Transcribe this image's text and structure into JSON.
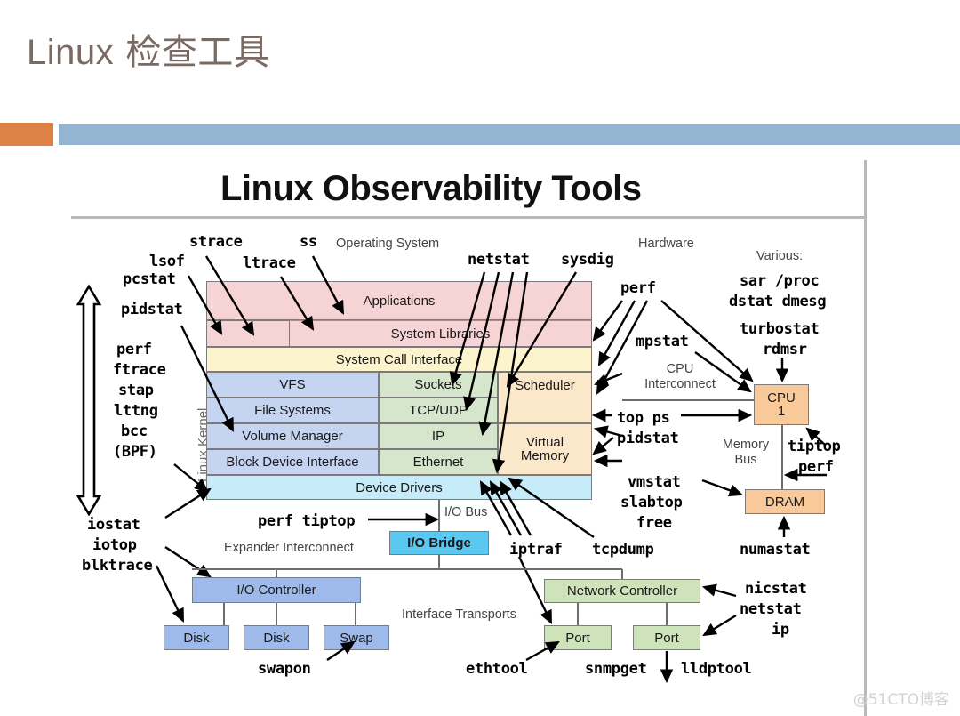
{
  "slide": {
    "title_latin": "Linux",
    "title_cjk": "检查工具",
    "accent_orange": "#dd8145",
    "accent_blue": "#93b5d2"
  },
  "diagram": {
    "title": "Linux Observability Tools",
    "section_labels": {
      "operating_system": "Operating System",
      "hardware": "Hardware",
      "various": "Various:",
      "linux_kernel": "Linux Kernel",
      "cpu_interconnect": "CPU\nInterconnect",
      "memory_bus": "Memory\nBus",
      "io_bus": "I/O Bus",
      "expander_interconnect": "Expander Interconnect",
      "interface_transports": "Interface Transports"
    },
    "blocks": {
      "applications": "Applications",
      "system_libraries": "System Libraries",
      "system_call_interface": "System Call Interface",
      "vfs": "VFS",
      "file_systems": "File Systems",
      "volume_manager": "Volume Manager",
      "block_device_interface": "Block Device Interface",
      "sockets": "Sockets",
      "tcp_udp": "TCP/UDP",
      "ip": "IP",
      "ethernet": "Ethernet",
      "scheduler": "Scheduler",
      "virtual_memory": "Virtual\nMemory",
      "device_drivers": "Device Drivers",
      "io_bridge": "I/O Bridge",
      "io_controller": "I/O Controller",
      "disk_1": "Disk",
      "disk_2": "Disk",
      "swap": "Swap",
      "network_controller": "Network Controller",
      "port_1": "Port",
      "port_2": "Port",
      "cpu": "CPU\n1",
      "dram": "DRAM"
    },
    "tools": {
      "lsof": "lsof",
      "pcstat": "pcstat",
      "pidstat_left": "pidstat",
      "strace": "strace",
      "ltrace": "ltrace",
      "ss": "ss",
      "netstat_top": "netstat",
      "sysdig": "sysdig",
      "perf_right": "perf",
      "sar_proc": "sar /proc",
      "dstat_dmesg": "dstat dmesg",
      "turbostat": "turbostat",
      "rdmsr": "rdmsr",
      "mpstat": "mpstat",
      "top_ps": "top ps",
      "pidstat_right": "pidstat",
      "tiptop_right": "tiptop",
      "perf_cpu": "perf",
      "vmstat": "vmstat",
      "slabtop": "slabtop",
      "free": "free",
      "numastat": "numastat",
      "perf_stack": "perf",
      "ftrace": "ftrace",
      "stap": "stap",
      "lttng": "lttng",
      "bcc": "bcc",
      "bpf": "(BPF)",
      "iostat": "iostat",
      "iotop": "iotop",
      "blktrace": "blktrace",
      "perf_tiptop": "perf tiptop",
      "iptraf": "iptraf",
      "tcpdump": "tcpdump",
      "swapon": "swapon",
      "ethtool": "ethtool",
      "snmpget": "snmpget",
      "lldptool": "lldptool",
      "nicstat": "nicstat",
      "netstat_right": "netstat",
      "ip": "ip"
    }
  },
  "watermark": "@51CTO博客"
}
